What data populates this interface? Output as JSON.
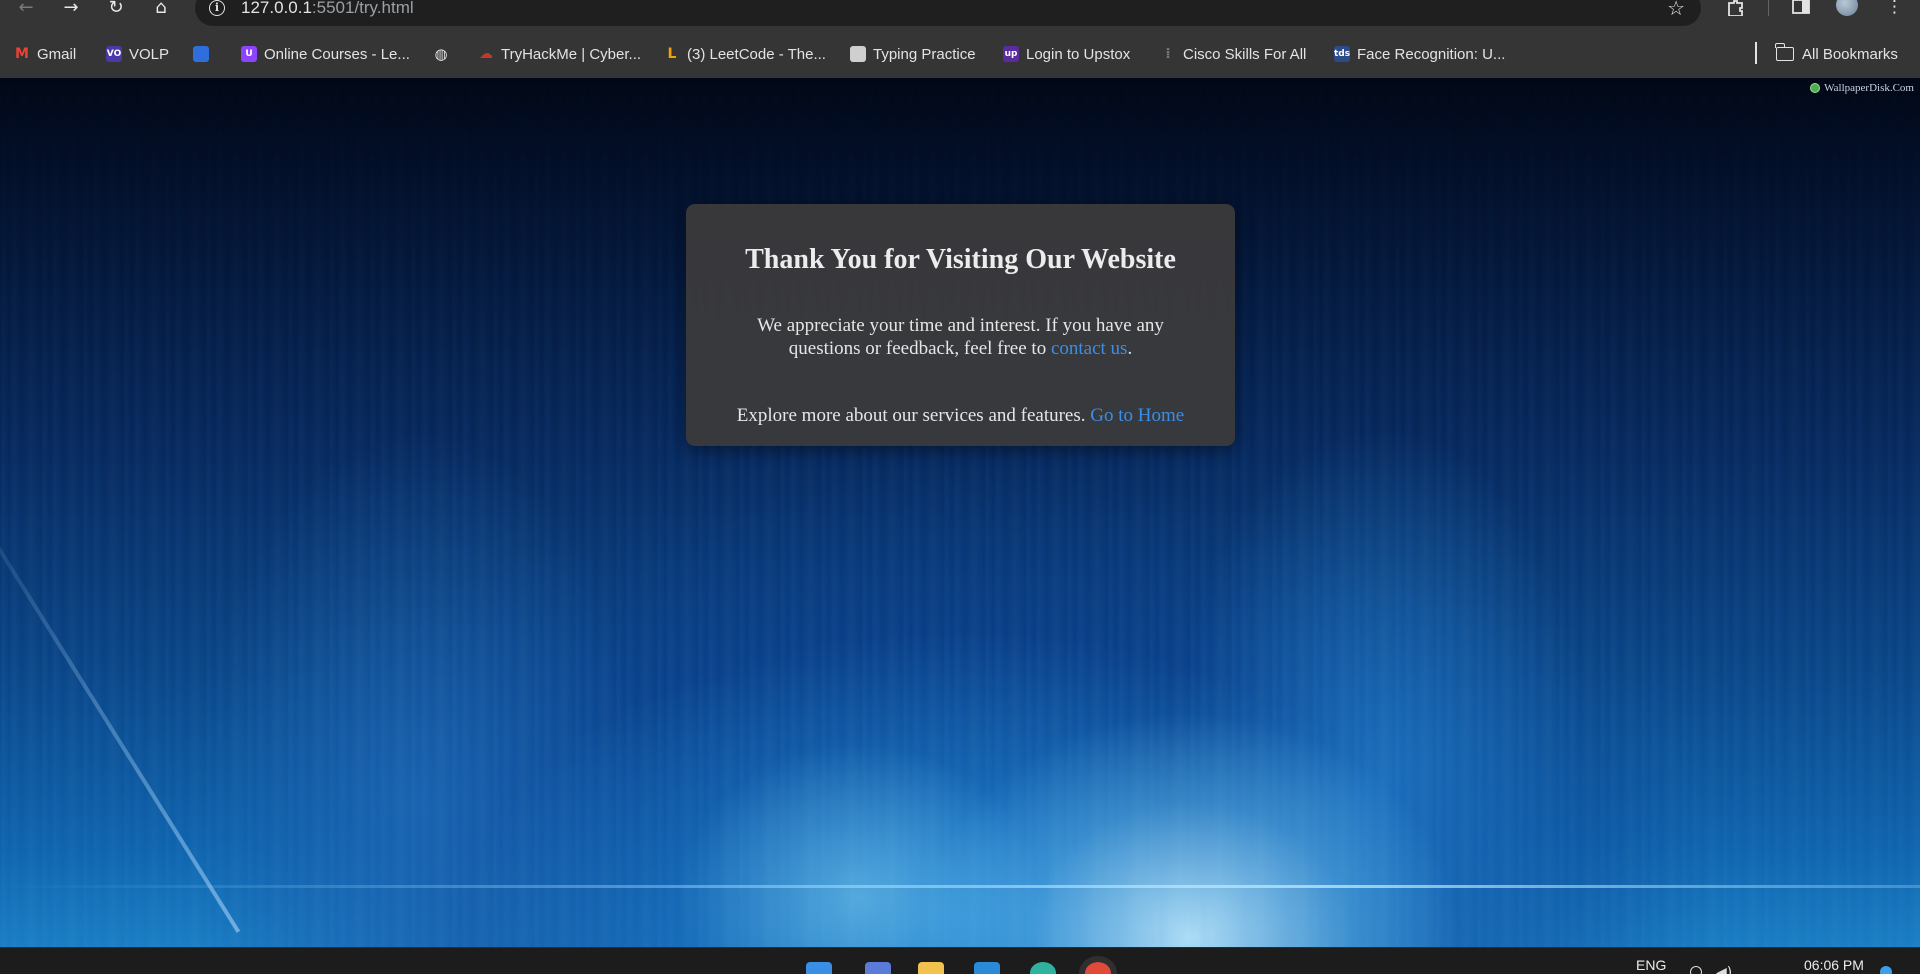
{
  "browser": {
    "url_host": "127.0.0.1",
    "url_rest": ":5501/try.html",
    "nav": {
      "back": "←",
      "forward": "→",
      "reload": "↻",
      "home": "⌂",
      "star": "☆",
      "menu": "⋮"
    },
    "bookmarks": [
      {
        "label": "Gmail",
        "icon": "gmail-icon",
        "color": "#ea4335",
        "glyph": "M"
      },
      {
        "label": "VOLP",
        "icon": "volp-icon",
        "color": "#4a3aa8",
        "glyph": "VO"
      },
      {
        "label": "",
        "icon": "bookmark-app-icon",
        "color": "#2f6fdc",
        "glyph": ""
      },
      {
        "label": "Online Courses - Le...",
        "icon": "courses-icon",
        "color": "#8e44ff",
        "glyph": "U"
      },
      {
        "label": "",
        "icon": "globe-icon",
        "color": "#e3e3e3",
        "glyph": "◍"
      },
      {
        "label": "TryHackMe | Cyber...",
        "icon": "tryhackme-icon",
        "color": "#c0392b",
        "glyph": "☁"
      },
      {
        "label": "(3) LeetCode - The...",
        "icon": "leetcode-icon",
        "color": "#f0a30a",
        "glyph": "L"
      },
      {
        "label": "Typing Practice",
        "icon": "typing-icon",
        "color": "#cfcfcf",
        "glyph": ""
      },
      {
        "label": "Login to Upstox",
        "icon": "upstox-icon",
        "color": "#5a2ca0",
        "glyph": "up"
      },
      {
        "label": "Cisco Skills For All",
        "icon": "cisco-icon",
        "color": "#7d7d7d",
        "glyph": "⁞"
      },
      {
        "label": "Face Recognition: U...",
        "icon": "face-recognition-icon",
        "color": "#2d4a8a",
        "glyph": "tds"
      }
    ],
    "all_bookmarks": "All Bookmarks"
  },
  "page": {
    "watermark": "WallpaperDisk.Com",
    "card": {
      "title": "Thank You for Visiting Our Website",
      "p1_before": "We appreciate your time and interest. If you have any questions or feedback, feel free to ",
      "p1_link": "contact us",
      "p1_after": ".",
      "p2_before": "Explore more about our services and features. ",
      "p2_link": "Go to Home"
    }
  },
  "taskbar": {
    "language": "ENG",
    "time": "06:06 PM",
    "apps": [
      {
        "name": "start-icon",
        "color": "#3a8ee6"
      },
      {
        "name": "copilot-icon",
        "color": "#5a7bd8"
      },
      {
        "name": "file-explorer-icon",
        "color": "#f2c14e"
      },
      {
        "name": "vscode-icon",
        "color": "#2b8ad8"
      },
      {
        "name": "edge-icon",
        "color": "#2fb3a0"
      },
      {
        "name": "chrome-icon",
        "color": "#e14a3b"
      }
    ]
  }
}
